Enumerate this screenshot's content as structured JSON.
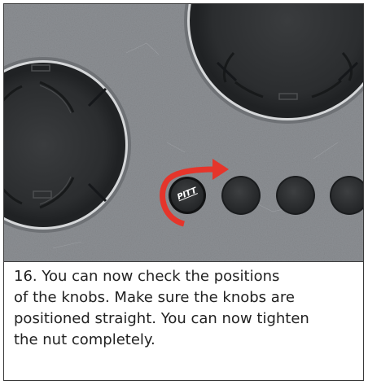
{
  "photo": {
    "logo_text": "PITT",
    "arrow_color": "#e5352b",
    "knob_color": "#2d2f31",
    "surface_color": "#8a8d91"
  },
  "caption": {
    "lines": [
      "16. You can now check the positions",
      "of the knobs. Make sure the knobs are",
      "positioned straight. You can now tighten",
      "the nut completely."
    ]
  }
}
